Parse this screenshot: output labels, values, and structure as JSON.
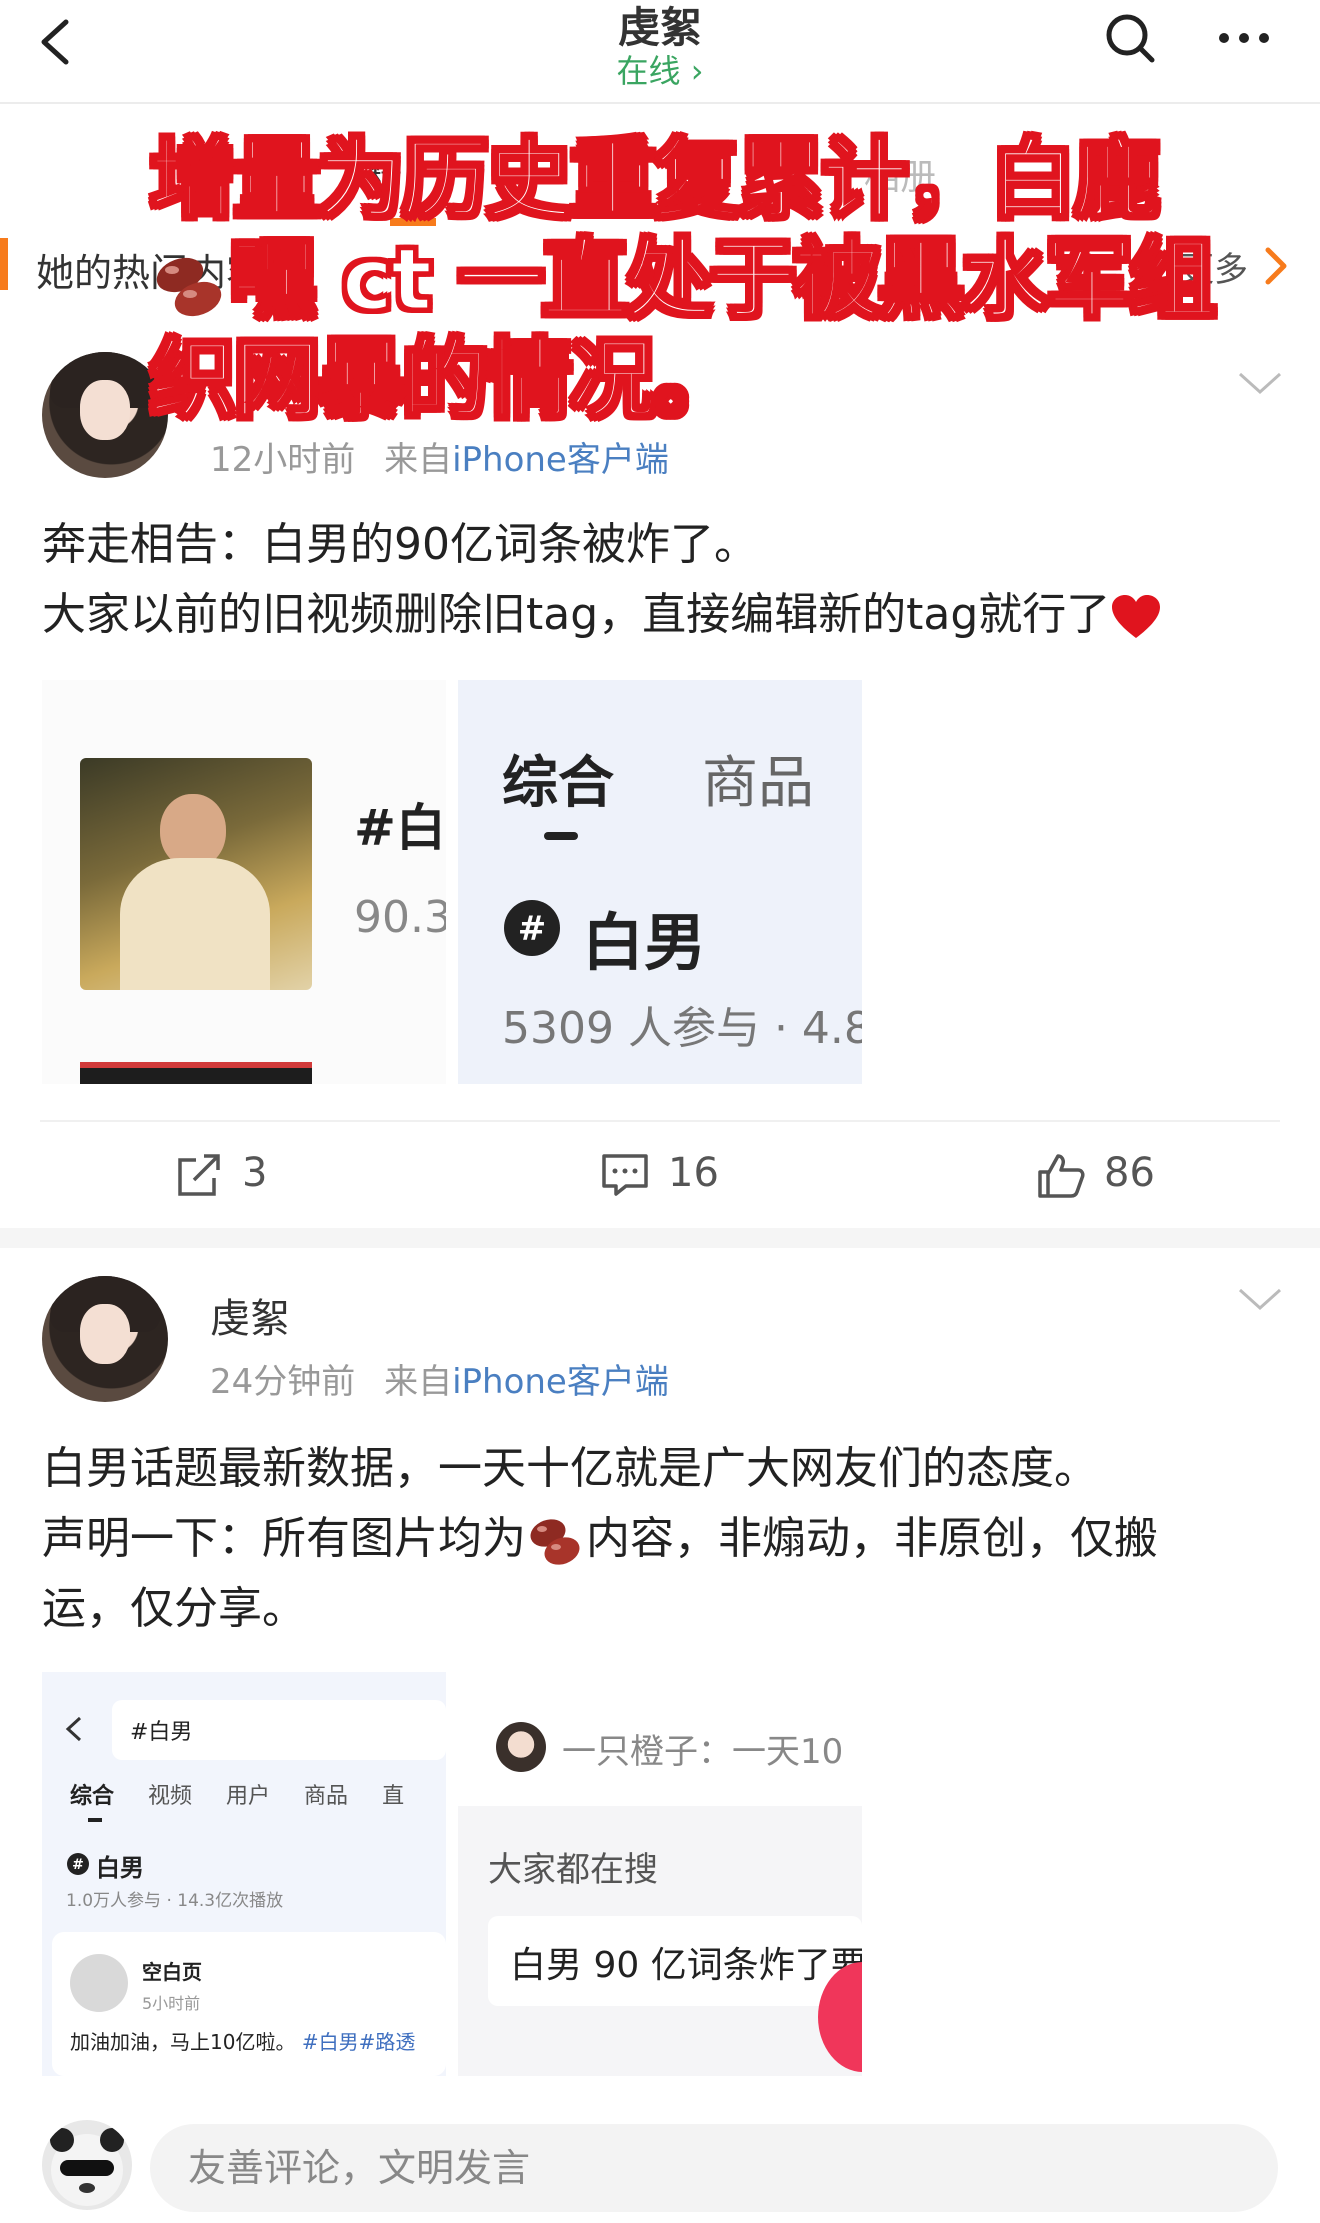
{
  "header": {
    "title": "虔絮",
    "status": "在线",
    "icons": [
      "back-icon",
      "search-icon",
      "more-icon"
    ]
  },
  "tabs": {
    "active_fragment": "精",
    "album": "相册"
  },
  "hot_section": {
    "title": "她的热门内容",
    "more": "更多"
  },
  "overlay_text": {
    "line1": "增量为历史重复累计，白鹿",
    "line2_suffix": "嘿 ct 一直处于被黑水军组",
    "line3": "织网暴的情况。"
  },
  "posts": [
    {
      "time": "12小时前",
      "source_prefix": "来自",
      "source": "iPhone客户端",
      "text_line1": "奔走相告：白男的90亿词条被炸了。",
      "text_line2": "大家以前的旧视频删除旧tag，直接编辑新的tag就行了",
      "image1": {
        "hash_fragment": "#白",
        "count_fragment": "90.3"
      },
      "image2": {
        "tab1": "综合",
        "tab2": "商品",
        "topic": "白男",
        "stats": "5309 人参与 · 4.8"
      },
      "actions": {
        "reposts": "3",
        "comments": "16",
        "likes": "86"
      }
    },
    {
      "username": "虔絮",
      "time": "24分钟前",
      "source_prefix": "来自",
      "source": "iPhone客户端",
      "text_line1": "白男话题最新数据，一天十亿就是广大网友们的态度。",
      "text_line2a": "声明一下：所有图片均为",
      "text_line2b": "内容，非煽动，非原创，仅搬",
      "text_line3": "运，仅分享。",
      "image1": {
        "search": "#白男",
        "tabs": [
          "综合",
          "视频",
          "用户",
          "商品",
          "直"
        ],
        "topic": "白男",
        "stats": "1.0万人参与 · 14.3亿次播放",
        "poster": "空白页",
        "poster_time": "5小时前",
        "post_text": "加油加油，马上10亿啦。",
        "post_tags": "#白男#路透"
      },
      "image2": {
        "commenter": "一只橙子：一天10",
        "section": "大家都在搜",
        "query": "白男 90 亿词条炸了要"
      }
    }
  ],
  "comment_bar": {
    "placeholder": "友善评论，文明发言"
  }
}
